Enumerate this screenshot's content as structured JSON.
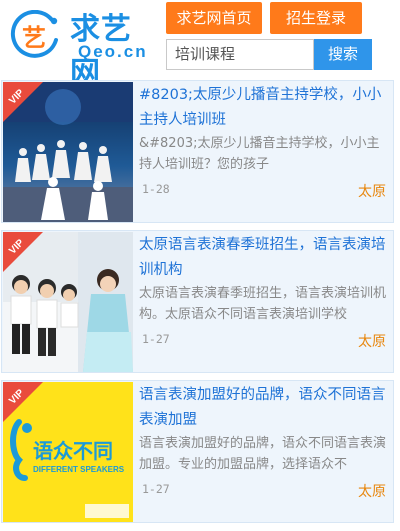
{
  "header": {
    "logo_char": "艺",
    "logo_word": "求艺网",
    "logo_domain": "Qeo.cn",
    "nav_home": "求艺网首页",
    "nav_login": "招生登录",
    "search_value": "培训课程",
    "search_button": "搜索"
  },
  "colors": {
    "brand_blue": "#1b8fe3",
    "nav_orange": "#ff7a1a",
    "title_blue": "#1e72d6",
    "city_orange": "#e8870e",
    "vip_red": "#e94b3c"
  },
  "vip_label": "VIP",
  "items": [
    {
      "title": "#8203;太原少儿播音主持学校，小小主持人培训班",
      "desc": "&#8203;太原少儿播音主持学校，小小主持人培训班？您的孩子",
      "date": "1-28",
      "city": "太原"
    },
    {
      "title": "太原语言表演春季班招生，语言表演培训机构",
      "desc": "太原语言表演春季班招生，语言表演培训机构。太原语众不同语言表演培训学校",
      "date": "1-27",
      "city": "太原"
    },
    {
      "title": "语言表演加盟好的品牌，语众不同语言表演加盟",
      "desc": "语言表演加盟好的品牌，语众不同语言表演加盟。专业的加盟品牌，选择语众不",
      "date": "1-27",
      "city": "太原",
      "logo_text": "语众不同",
      "logo_en": "DIFFERENT SPEAKERS"
    }
  ]
}
